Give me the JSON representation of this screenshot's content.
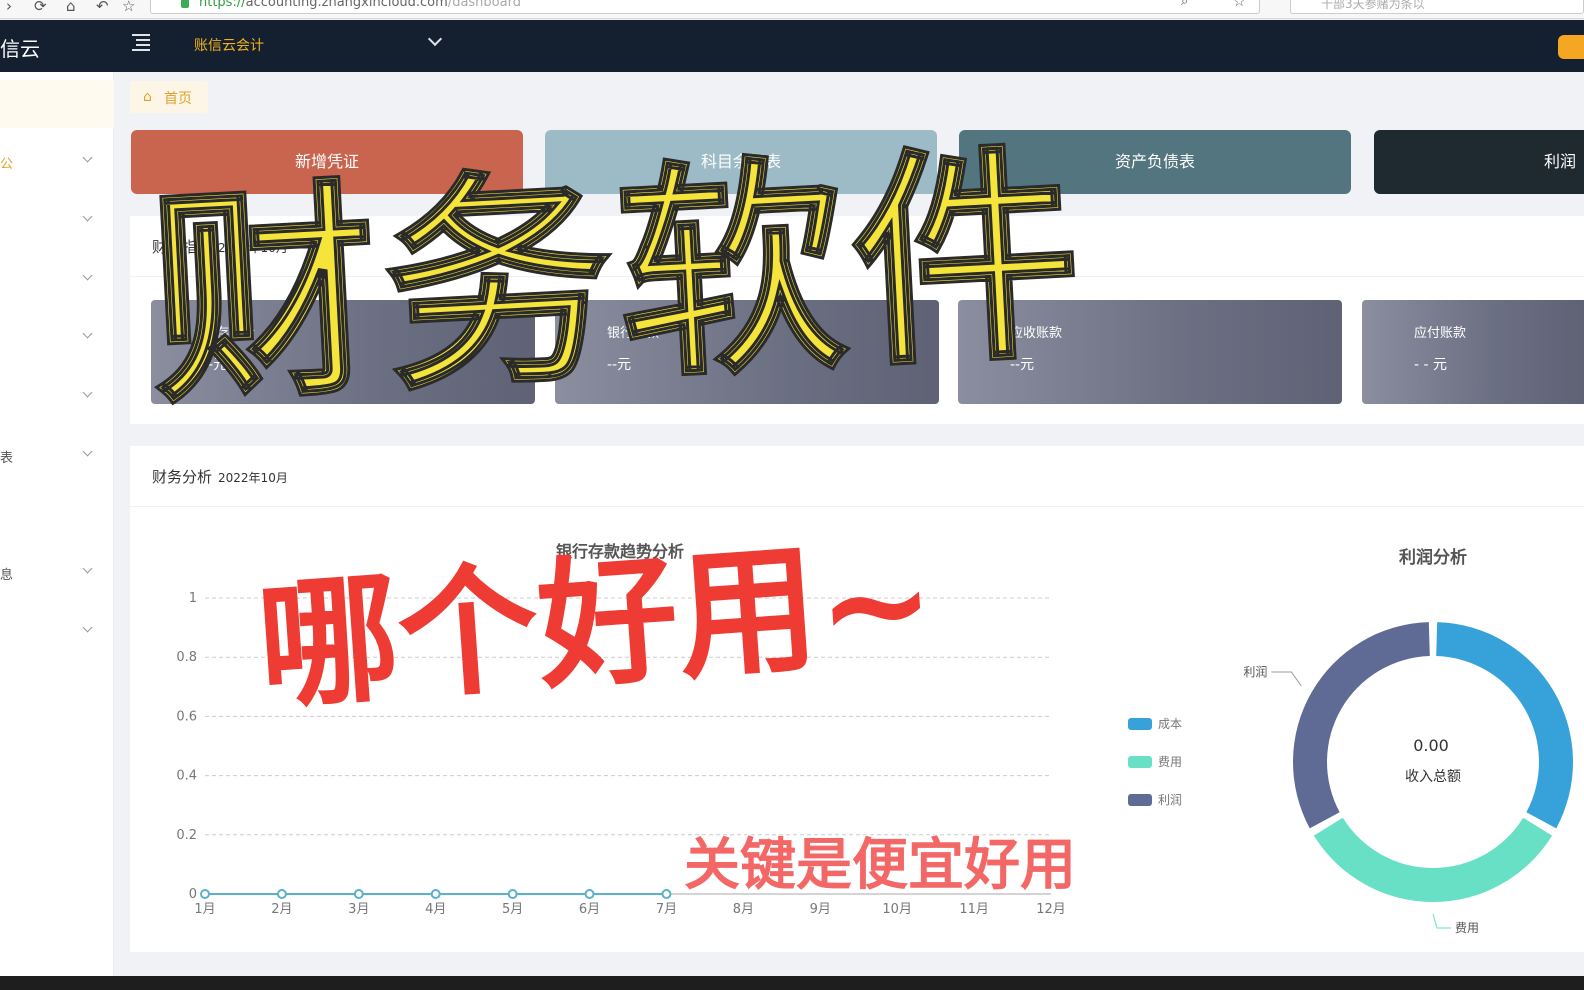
{
  "browser": {
    "url_scheme": "https://",
    "url_host": "accounting.zhangxincloud.com",
    "url_path": "/dashboard",
    "search_text": "十部3天参赌为条以"
  },
  "header": {
    "brand": "信云",
    "app_name": "账信云会计"
  },
  "sidebar": {
    "items": [
      {
        "label": "公"
      },
      {
        "label": ""
      },
      {
        "label": ""
      },
      {
        "label": ""
      },
      {
        "label": ""
      },
      {
        "label": "表"
      },
      {
        "label": "息"
      },
      {
        "label": ""
      }
    ]
  },
  "tabs": {
    "home": "首页"
  },
  "quick_actions": [
    {
      "label": "新增凭证",
      "color": "#c9654f"
    },
    {
      "label": "科目余额表",
      "color": "#9dbbc7"
    },
    {
      "label": "资产负债表",
      "color": "#52757f"
    },
    {
      "label": "利润表",
      "color": "#1e2a30"
    }
  ],
  "funds_panel": {
    "title": "财务指标",
    "period": "2022年10月",
    "cards": [
      {
        "label": "库存现金",
        "value": "--元"
      },
      {
        "label": "银行存款",
        "value": "--元"
      },
      {
        "label": "应收账款",
        "value": "--元"
      },
      {
        "label": "应付账款",
        "value": "- - 元"
      }
    ]
  },
  "analysis_panel": {
    "title": "财务分析",
    "period": "2022年10月"
  },
  "chart_data": [
    {
      "type": "line",
      "title": "银行存款趋势分析",
      "categories": [
        "1月",
        "2月",
        "3月",
        "4月",
        "5月",
        "6月",
        "7月",
        "8月",
        "9月",
        "10月",
        "11月",
        "12月"
      ],
      "values": [
        0,
        0,
        0,
        0,
        0,
        0,
        0,
        null,
        null,
        null,
        null,
        null
      ],
      "y_ticks": [
        "0",
        "0.2",
        "0.4",
        "0.6",
        "0.8",
        "1"
      ],
      "ylim": [
        0,
        1
      ],
      "grid": true,
      "color": "#5ab1c9"
    },
    {
      "type": "pie",
      "title": "利润分析",
      "center_value": "0.00",
      "center_label": "收入总额",
      "legend_position": "left",
      "series": [
        {
          "name": "成本",
          "value": 1,
          "color": "#37a2da"
        },
        {
          "name": "费用",
          "value": 1,
          "color": "#67e0c5"
        },
        {
          "name": "利润",
          "value": 1,
          "color": "#5f6b94"
        }
      ]
    }
  ],
  "overlays": {
    "headline": "财务软件",
    "question": "哪个好用~",
    "caption": "关键是便宜好用"
  }
}
